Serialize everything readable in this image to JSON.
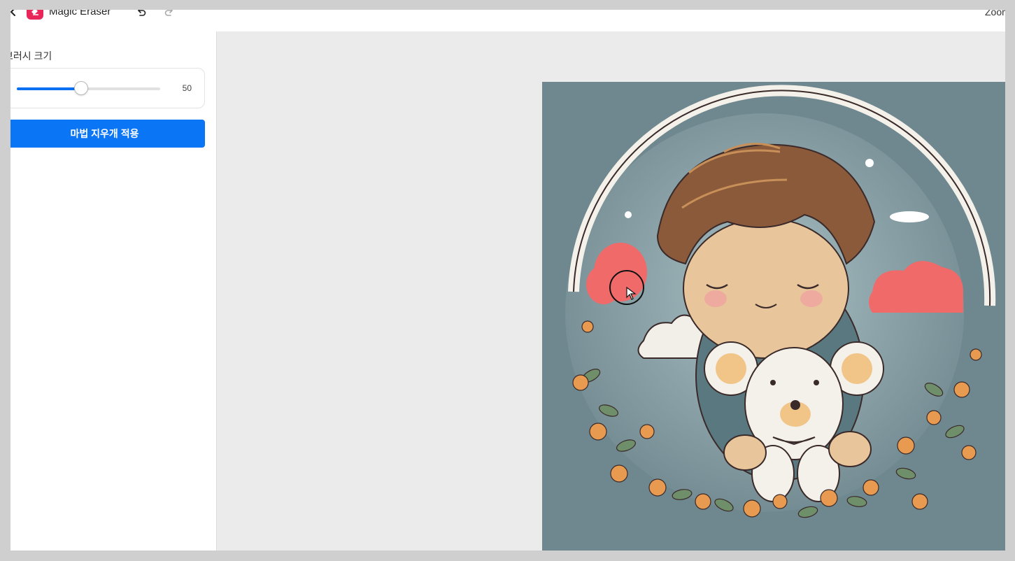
{
  "header": {
    "app_title": "Magic Eraser",
    "zoom_label": "Zoom"
  },
  "icons": {
    "back": "chevron-left-icon",
    "logo": "eraser-icon",
    "undo": "undo-icon",
    "redo": "redo-icon",
    "cursor": "brush-cursor-icon"
  },
  "sidebar": {
    "brush_size_label": "브러시 크기",
    "brush_size_value": "50",
    "brush_size_fraction": 0.45,
    "apply_button_label": "마법 지우개 적용"
  },
  "colors": {
    "accent": "#0a76f6",
    "logo": "#e8265a",
    "canvas_bg": "#ebebeb",
    "image_bg": "#6f878e",
    "mask_red": "#f06a6a"
  }
}
